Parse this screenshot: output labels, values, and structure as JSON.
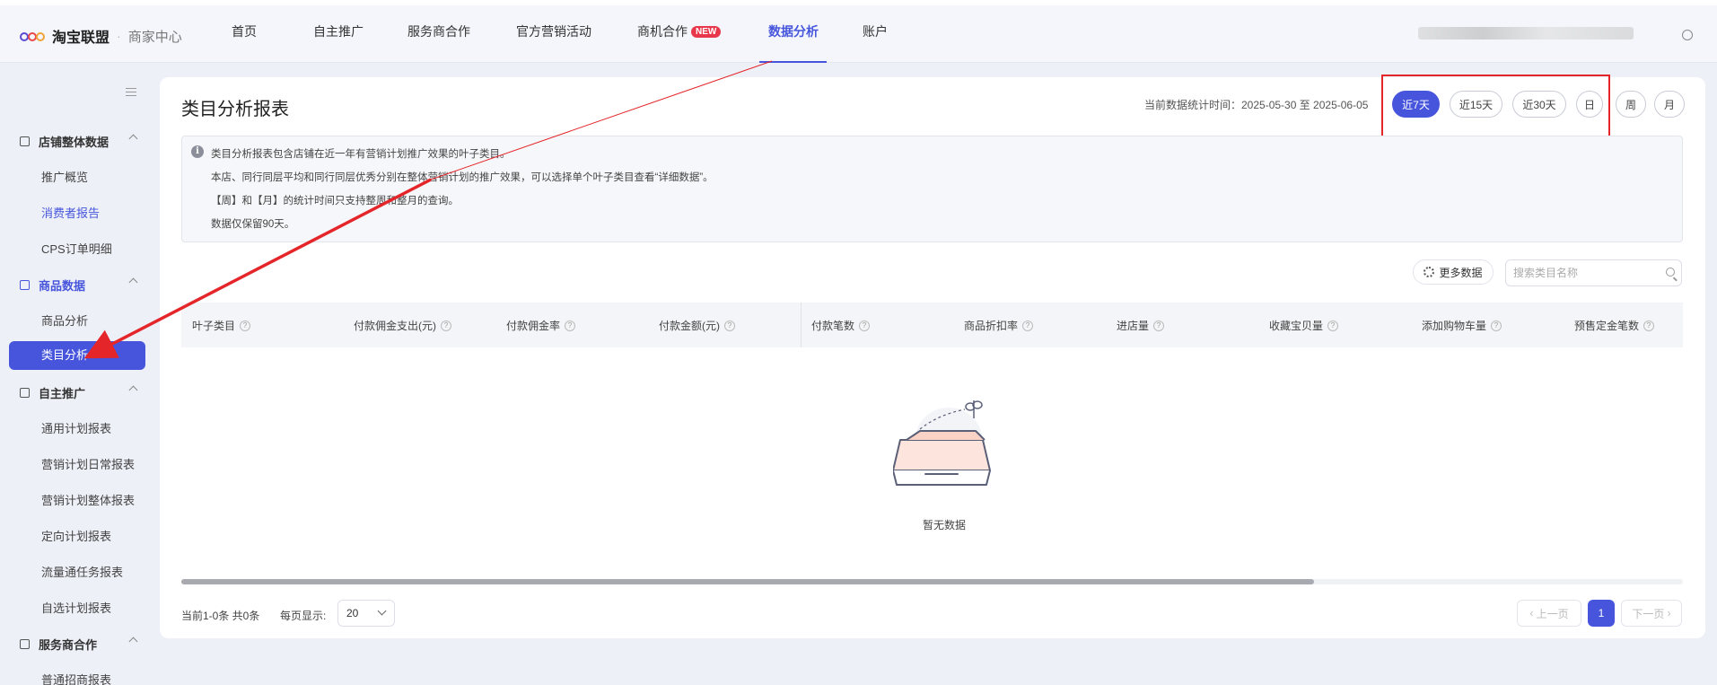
{
  "header": {
    "logo_text": "淘宝联盟",
    "logo_separator": "·",
    "logo_sub": "商家中心",
    "nav": [
      {
        "label": "首页"
      },
      {
        "label": "自主推广"
      },
      {
        "label": "服务商合作"
      },
      {
        "label": "官方营销活动"
      },
      {
        "label": "商机合作",
        "badge": "NEW"
      },
      {
        "label": "数据分析",
        "active": true
      },
      {
        "label": "账户"
      }
    ]
  },
  "sidebar": {
    "groups": [
      {
        "label": "店铺整体数据",
        "items": [
          "推广概览",
          "消费者报告",
          "CPS订单明细"
        ]
      },
      {
        "label": "商品数据",
        "items": [
          "商品分析",
          "类目分析"
        ]
      },
      {
        "label": "自主推广",
        "items": [
          "通用计划报表",
          "营销计划日常报表",
          "营销计划整体报表",
          "定向计划报表",
          "流量通任务报表",
          "自选计划报表"
        ]
      },
      {
        "label": "服务商合作",
        "items": [
          "普通招商报表"
        ]
      }
    ],
    "active_item": "类目分析"
  },
  "main": {
    "title": "类目分析报表",
    "stat_time": "当前数据统计时间：2025-05-30 至 2025-06-05",
    "ranges": [
      {
        "label": "近7天",
        "active": true
      },
      {
        "label": "近15天"
      },
      {
        "label": "近30天"
      },
      {
        "label": "日"
      },
      {
        "label": "周"
      },
      {
        "label": "月"
      }
    ],
    "notice": {
      "icon": "i",
      "lines": [
        "类目分析报表包含店铺在近一年有营销计划推广效果的叶子类目。",
        "本店、同行同层平均和同行同层优秀分别在整体营销计划的推广效果，可以选择单个叶子类目查看“详细数据”。",
        "【周】和【月】的统计时间只支持整周和整月的查询。",
        "数据仅保留90天。"
      ]
    },
    "more_data": "更多数据",
    "search_placeholder": "搜索类目名称",
    "columns": [
      "叶子类目",
      "付款佣金支出(元)",
      "付款佣金率",
      "付款金额(元)",
      "付款笔数",
      "商品折扣率",
      "进店量",
      "收藏宝贝量",
      "添加购物车量",
      "预售定金笔数"
    ],
    "empty_text": "暂无数据",
    "pagination": {
      "info": "当前1-0条 共0条",
      "page_size_label": "每页显示:",
      "page_size": "20",
      "prev": "上一页",
      "current": "1",
      "next": "下一页"
    }
  },
  "colors": {
    "accent": "#4655dc",
    "annotation": "#e4262a"
  }
}
